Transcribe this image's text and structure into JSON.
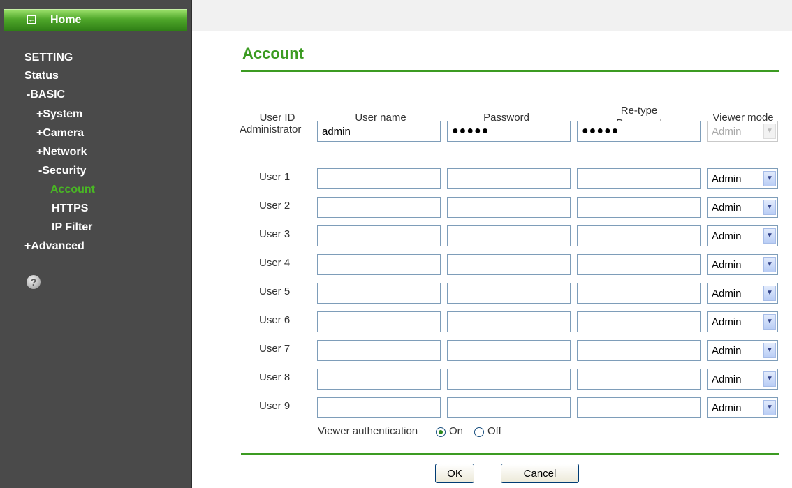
{
  "sidebar": {
    "home_label": "Home",
    "items": [
      {
        "label": "SETTING"
      },
      {
        "label": "Status"
      },
      {
        "label": "-BASIC"
      },
      {
        "label": "+System"
      },
      {
        "label": "+Camera"
      },
      {
        "label": "+Network"
      },
      {
        "label": "-Security"
      },
      {
        "label": "Account"
      },
      {
        "label": "HTTPS"
      },
      {
        "label": "IP Filter"
      },
      {
        "label": "+Advanced"
      }
    ],
    "help_icon_glyph": "?"
  },
  "page": {
    "title": "Account"
  },
  "table": {
    "headers": {
      "user_id": "User ID",
      "user_name": "User name",
      "password": "Password",
      "retype_line1": "Re-type",
      "retype_line2": "Password",
      "viewer_mode": "Viewer mode"
    },
    "admin": {
      "label": "Administrator",
      "username": "admin",
      "password": "●●●●●",
      "retype": "●●●●●",
      "mode": "Admin"
    },
    "users": [
      {
        "label": "User 1",
        "mode": "Admin"
      },
      {
        "label": "User 2",
        "mode": "Admin"
      },
      {
        "label": "User 3",
        "mode": "Admin"
      },
      {
        "label": "User 4",
        "mode": "Admin"
      },
      {
        "label": "User 5",
        "mode": "Admin"
      },
      {
        "label": "User 6",
        "mode": "Admin"
      },
      {
        "label": "User 7",
        "mode": "Admin"
      },
      {
        "label": "User 8",
        "mode": "Admin"
      },
      {
        "label": "User 9",
        "mode": "Admin"
      }
    ]
  },
  "auth": {
    "label": "Viewer authentication",
    "on_label": "On",
    "off_label": "Off",
    "selected": "On"
  },
  "buttons": {
    "ok": "OK",
    "cancel": "Cancel"
  },
  "colors": {
    "accent_green": "#3c9b22",
    "sidebar_bg": "#4a4a4a",
    "active_nav": "#49b624"
  },
  "icons": {
    "home": "back-arrow-icon",
    "help": "help-icon",
    "dropdown": "chevron-down-icon"
  }
}
